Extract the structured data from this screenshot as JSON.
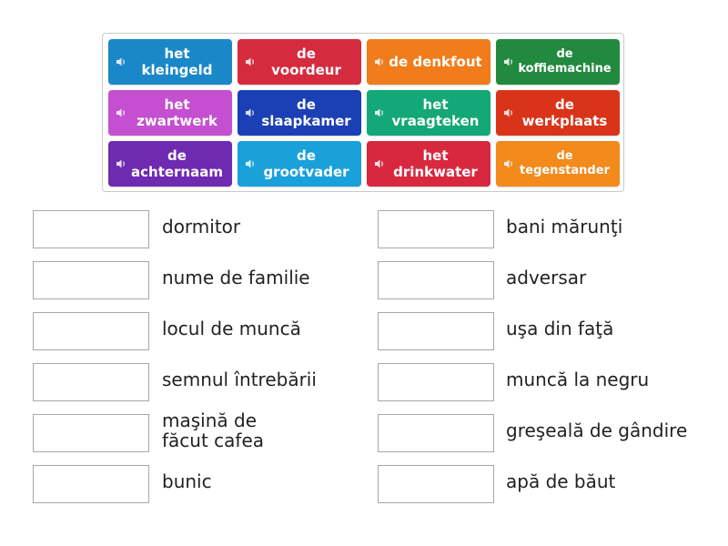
{
  "tiles": [
    {
      "text": "het\nkleingeld",
      "color": "#1a88c8",
      "small": false
    },
    {
      "text": "de\nvoordeur",
      "color": "#d52b3e",
      "small": false
    },
    {
      "text": "de denkfout",
      "color": "#f07c1b",
      "small": false
    },
    {
      "text": "de\nkoffiemachine",
      "color": "#218a3f",
      "small": true
    },
    {
      "text": "het\nzwartwerk",
      "color": "#c44fd0",
      "small": false
    },
    {
      "text": "de\nslaapkamer",
      "color": "#1b3fb4",
      "small": false
    },
    {
      "text": "het\nvraagteken",
      "color": "#14a777",
      "small": false
    },
    {
      "text": "de\nwerkplaats",
      "color": "#d9341a",
      "small": false
    },
    {
      "text": "de\nachternaam",
      "color": "#6e2ab0",
      "small": false
    },
    {
      "text": "de\ngrootvader",
      "color": "#1aa1da",
      "small": false
    },
    {
      "text": "het\ndrinkwater",
      "color": "#d82840",
      "small": false
    },
    {
      "text": "de\ntegenstander",
      "color": "#f28a1c",
      "small": true
    }
  ],
  "left_items": [
    "dormitor",
    "nume de familie",
    "locul de muncă",
    "semnul întrebării",
    "maşină de\nfăcut cafea",
    "bunic"
  ],
  "right_items": [
    "bani mărunţi",
    "adversar",
    "uşa din faţă",
    "muncă la negru",
    "greşeală de gândire",
    "apă de băut"
  ],
  "icon": "speaker-icon"
}
